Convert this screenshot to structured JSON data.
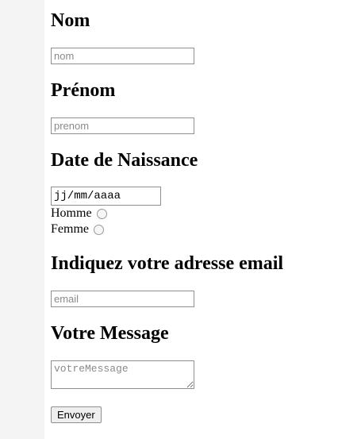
{
  "form": {
    "nom": {
      "heading": "Nom",
      "placeholder": "nom",
      "value": ""
    },
    "prenom": {
      "heading": "Prénom",
      "placeholder": "prenom",
      "value": ""
    },
    "naissance": {
      "heading": "Date de Naissance",
      "date_display": "jj/mm/aaaa"
    },
    "sexe": [
      {
        "label": "Homme",
        "checked": false
      },
      {
        "label": "Femme",
        "checked": false
      }
    ],
    "email": {
      "heading": "Indiquez votre adresse email",
      "placeholder": "email",
      "value": ""
    },
    "message": {
      "heading": "Votre Message",
      "placeholder": "votreMessage",
      "value": ""
    },
    "submit_label": "Envoyer"
  }
}
